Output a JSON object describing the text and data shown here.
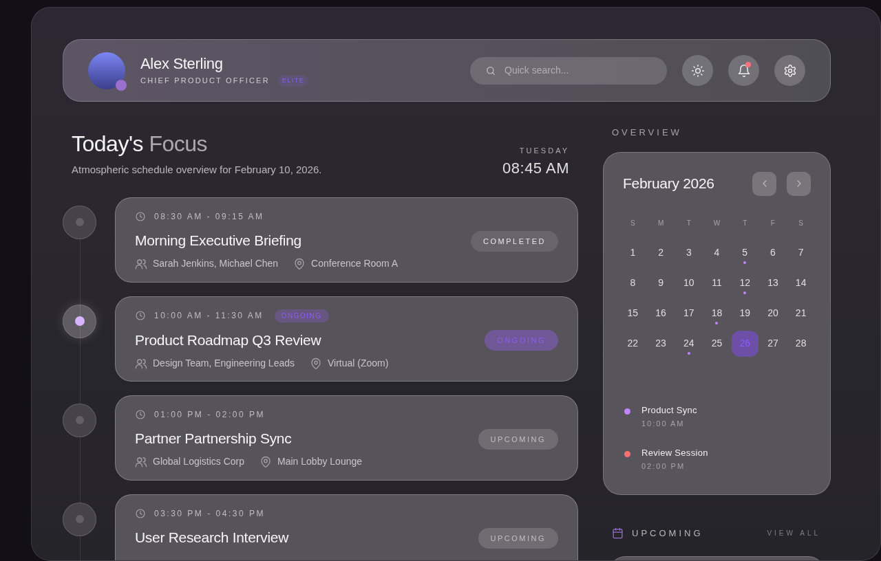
{
  "profile": {
    "name": "Alex Sterling",
    "role": "CHIEF PRODUCT OFFICER",
    "badge": "ELITE",
    "online": true
  },
  "search": {
    "placeholder": "Quick search..."
  },
  "header_actions": [
    {
      "kind": "theme",
      "notification": false
    },
    {
      "kind": "bell",
      "notification": true
    },
    {
      "kind": "settings",
      "notification": false
    }
  ],
  "focus": {
    "title": "Today's",
    "title_accent": "Focus",
    "subtitle": "Atmospheric schedule overview for February 10, 2026.",
    "weekday": "TUESDAY",
    "time": "08:45 AM"
  },
  "events": [
    {
      "time": "08:30 AM - 09:15 AM",
      "title": "Morning Executive Briefing",
      "people": "Sarah Jenkins, Michael Chen",
      "place": "Conference Room A",
      "kind": "completed",
      "status_label": "COMPLETED"
    },
    {
      "time": "10:00 AM - 11:30 AM",
      "title": "Product Roadmap Q3 Review",
      "people": "Design Team, Engineering Leads",
      "place": "Virtual (Zoom)",
      "kind": "ongoing",
      "status_label": "ONGOING",
      "inline_badge": "ONGOING"
    },
    {
      "time": "01:00 PM - 02:00 PM",
      "title": "Partner Partnership Sync",
      "people": "Global Logistics Corp",
      "place": "Main Lobby Lounge",
      "kind": "upcoming",
      "status_label": "UPCOMING"
    },
    {
      "time": "03:30 PM - 04:30 PM",
      "title": "User Research Interview",
      "kind": "upcoming",
      "status_label": "UPCOMING"
    }
  ],
  "overview": {
    "heading": "OVERVIEW",
    "month": "February 2026",
    "weekdays": [
      "S",
      "M",
      "T",
      "W",
      "T",
      "F",
      "S"
    ],
    "days": [
      {
        "label": "1",
        "event": false,
        "selected": false
      },
      {
        "label": "2",
        "event": false,
        "selected": false
      },
      {
        "label": "3",
        "event": false,
        "selected": false
      },
      {
        "label": "4",
        "event": false,
        "selected": false
      },
      {
        "label": "5",
        "event": true,
        "selected": false
      },
      {
        "label": "6",
        "event": false,
        "selected": false
      },
      {
        "label": "7",
        "event": false,
        "selected": false
      },
      {
        "label": "8",
        "event": false,
        "selected": false
      },
      {
        "label": "9",
        "event": false,
        "selected": false
      },
      {
        "label": "10",
        "event": false,
        "selected": false
      },
      {
        "label": "11",
        "event": false,
        "selected": false
      },
      {
        "label": "12",
        "event": true,
        "selected": false
      },
      {
        "label": "13",
        "event": false,
        "selected": false
      },
      {
        "label": "14",
        "event": false,
        "selected": false
      },
      {
        "label": "15",
        "event": false,
        "selected": false
      },
      {
        "label": "16",
        "event": false,
        "selected": false
      },
      {
        "label": "17",
        "event": false,
        "selected": false
      },
      {
        "label": "18",
        "event": true,
        "selected": false
      },
      {
        "label": "19",
        "event": false,
        "selected": false
      },
      {
        "label": "20",
        "event": false,
        "selected": false
      },
      {
        "label": "21",
        "event": false,
        "selected": false
      },
      {
        "label": "22",
        "event": false,
        "selected": false
      },
      {
        "label": "23",
        "event": false,
        "selected": false
      },
      {
        "label": "24",
        "event": true,
        "selected": false
      },
      {
        "label": "25",
        "event": false,
        "selected": false
      },
      {
        "label": "26",
        "event": false,
        "selected": true
      },
      {
        "label": "27",
        "event": false,
        "selected": false
      },
      {
        "label": "28",
        "event": false,
        "selected": false
      }
    ],
    "agenda": [
      {
        "title": "Product Sync",
        "time": "10:00 AM",
        "color": "#c084fc"
      },
      {
        "title": "Review Session",
        "time": "02:00 PM",
        "color": "#f87171"
      }
    ]
  },
  "upcoming": {
    "heading": "UPCOMING",
    "link": "VIEW ALL"
  }
}
